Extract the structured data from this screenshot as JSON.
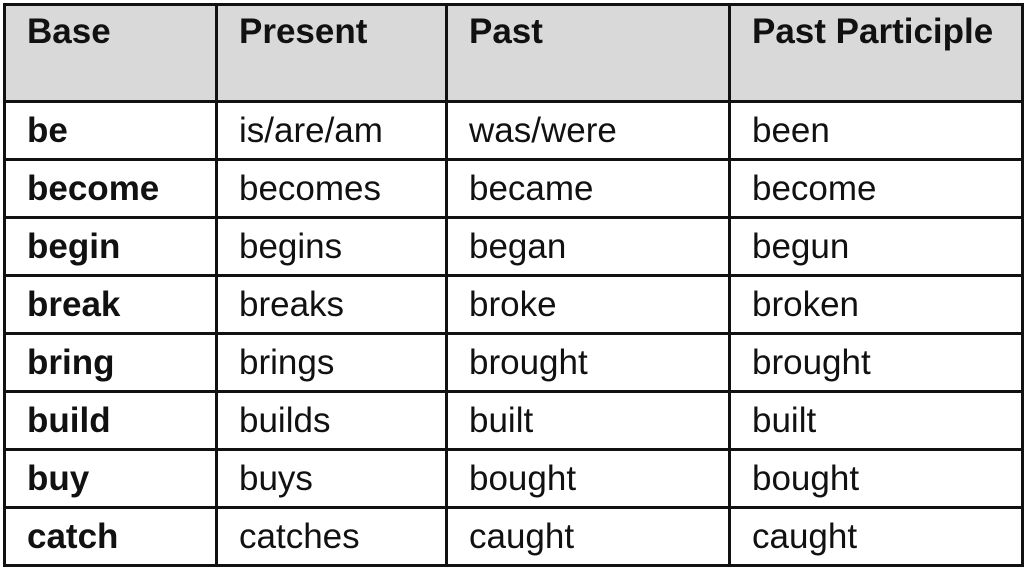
{
  "table": {
    "headers": [
      "Base",
      "Present",
      "Past",
      "Past Participle"
    ],
    "header_bg_color": "#d9d9d9",
    "rows": [
      [
        "be",
        "is/are/am",
        "was/were",
        "been"
      ],
      [
        "become",
        "becomes",
        "became",
        "become"
      ],
      [
        "begin",
        "begins",
        "began",
        "begun"
      ],
      [
        "break",
        "breaks",
        "broke",
        "broken"
      ],
      [
        "bring",
        "brings",
        "brought",
        "brought"
      ],
      [
        "build",
        "builds",
        "built",
        "built"
      ],
      [
        "buy",
        "buys",
        "bought",
        "bought"
      ],
      [
        "catch",
        "catches",
        "caught",
        "caught"
      ]
    ]
  }
}
